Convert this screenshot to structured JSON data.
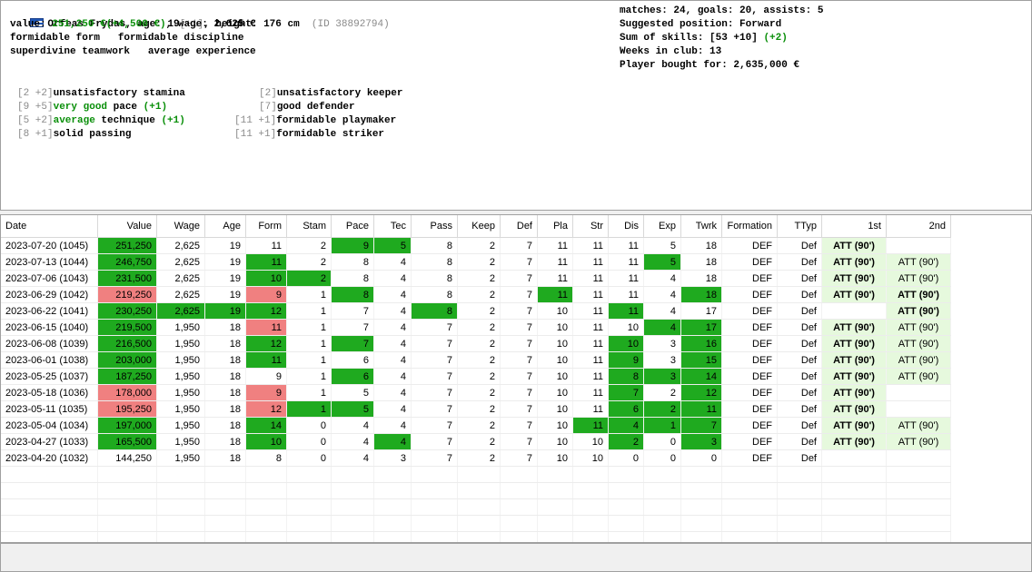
{
  "player": {
    "name": "Orfeas Frydas",
    "age_label": ", age: ",
    "age": "19",
    "age_delta": "[+1]",
    "height_label": ", height: ",
    "height": "176 cm",
    "id": "(ID 38892794)",
    "value_label": "value: ",
    "value": "251,250 €(+4,500 €)",
    "wage_label": ", wage: ",
    "wage": "2,625 €",
    "line3": "formidable form   formidable discipline",
    "line4": "superdivine teamwork   average experience"
  },
  "stats_right": {
    "matches": "matches: 24, goals: 20, assists: 5",
    "position": "Suggested position: Forward",
    "skills_label": "Sum of skills: [53 +10] ",
    "skills_delta": "(+2)",
    "weeks": "Weeks in club: 13",
    "bought": "Player bought for: 2,635,000 €"
  },
  "skills": {
    "stamina_pre": "[2 +2]",
    "stamina": "unsatisfactory stamina",
    "pace_pre": "[9 +5]",
    "pace": "very good",
    "pace_word": " pace ",
    "pace_delta": "(+1)",
    "tech_pre": "[5 +2]",
    "tech": "average",
    "tech_word": " technique ",
    "tech_delta": "(+1)",
    "pass_pre": "[8 +1]",
    "pass": "solid passing",
    "keeper_pre": "[2]",
    "keeper": "unsatisfactory keeper",
    "defender_pre": "[7]",
    "defender": "good defender",
    "playmaker_pre": "[11 +1]",
    "playmaker": "formidable playmaker",
    "striker_pre": "[11 +1]",
    "striker": "formidable striker"
  },
  "colors": {
    "green": "#1faa1f",
    "red": "#f08080",
    "light_green": "#e6f9dd"
  },
  "table": {
    "headers": [
      "Date",
      "Value",
      "Wage",
      "Age",
      "Form",
      "Stam",
      "Pace",
      "Tec",
      "Pass",
      "Keep",
      "Def",
      "Pla",
      "Str",
      "Dis",
      "Exp",
      "Twrk",
      "Formation",
      "TTyp",
      "1st",
      "2nd"
    ],
    "rows": [
      [
        "2023-07-20 (1045)",
        "251,250",
        "2,625",
        "19",
        "11",
        "2",
        "9",
        "5",
        "8",
        "2",
        "7",
        "11",
        "11",
        "11",
        "5",
        "18",
        "DEF",
        "Def",
        "ATT (90')",
        ""
      ],
      [
        "2023-07-13 (1044)",
        "246,750",
        "2,625",
        "19",
        "11",
        "2",
        "8",
        "4",
        "8",
        "2",
        "7",
        "11",
        "11",
        "11",
        "5",
        "18",
        "DEF",
        "Def",
        "ATT (90')",
        "ATT (90')"
      ],
      [
        "2023-07-06 (1043)",
        "231,500",
        "2,625",
        "19",
        "10",
        "2",
        "8",
        "4",
        "8",
        "2",
        "7",
        "11",
        "11",
        "11",
        "4",
        "18",
        "DEF",
        "Def",
        "ATT (90')",
        "ATT (90')"
      ],
      [
        "2023-06-29 (1042)",
        "219,250",
        "2,625",
        "19",
        "9",
        "1",
        "8",
        "4",
        "8",
        "2",
        "7",
        "11",
        "11",
        "11",
        "4",
        "18",
        "DEF",
        "Def",
        "ATT (90')",
        "ATT (90')"
      ],
      [
        "2023-06-22 (1041)",
        "230,250",
        "2,625",
        "19",
        "12",
        "1",
        "7",
        "4",
        "8",
        "2",
        "7",
        "10",
        "11",
        "11",
        "4",
        "17",
        "DEF",
        "Def",
        "",
        "ATT (90')"
      ],
      [
        "2023-06-15 (1040)",
        "219,500",
        "1,950",
        "18",
        "11",
        "1",
        "7",
        "4",
        "7",
        "2",
        "7",
        "10",
        "11",
        "10",
        "4",
        "17",
        "DEF",
        "Def",
        "ATT (90')",
        "ATT (90')"
      ],
      [
        "2023-06-08 (1039)",
        "216,500",
        "1,950",
        "18",
        "12",
        "1",
        "7",
        "4",
        "7",
        "2",
        "7",
        "10",
        "11",
        "10",
        "3",
        "16",
        "DEF",
        "Def",
        "ATT (90')",
        "ATT (90')"
      ],
      [
        "2023-06-01 (1038)",
        "203,000",
        "1,950",
        "18",
        "11",
        "1",
        "6",
        "4",
        "7",
        "2",
        "7",
        "10",
        "11",
        "9",
        "3",
        "15",
        "DEF",
        "Def",
        "ATT (90')",
        "ATT (90')"
      ],
      [
        "2023-05-25 (1037)",
        "187,250",
        "1,950",
        "18",
        "9",
        "1",
        "6",
        "4",
        "7",
        "2",
        "7",
        "10",
        "11",
        "8",
        "3",
        "14",
        "DEF",
        "Def",
        "ATT (90')",
        "ATT (90')"
      ],
      [
        "2023-05-18 (1036)",
        "178,000",
        "1,950",
        "18",
        "9",
        "1",
        "5",
        "4",
        "7",
        "2",
        "7",
        "10",
        "11",
        "7",
        "2",
        "12",
        "DEF",
        "Def",
        "ATT (90')",
        ""
      ],
      [
        "2023-05-11 (1035)",
        "195,250",
        "1,950",
        "18",
        "12",
        "1",
        "5",
        "4",
        "7",
        "2",
        "7",
        "10",
        "11",
        "6",
        "2",
        "11",
        "DEF",
        "Def",
        "ATT (90')",
        ""
      ],
      [
        "2023-05-04 (1034)",
        "197,000",
        "1,950",
        "18",
        "14",
        "0",
        "4",
        "4",
        "7",
        "2",
        "7",
        "10",
        "11",
        "4",
        "1",
        "7",
        "DEF",
        "Def",
        "ATT (90')",
        "ATT (90')"
      ],
      [
        "2023-04-27 (1033)",
        "165,500",
        "1,950",
        "18",
        "10",
        "0",
        "4",
        "4",
        "7",
        "2",
        "7",
        "10",
        "10",
        "2",
        "0",
        "3",
        "DEF",
        "Def",
        "ATT (90')",
        "ATT (90')"
      ],
      [
        "2023-04-20 (1032)",
        "144,250",
        "1,950",
        "18",
        "8",
        "0",
        "4",
        "3",
        "7",
        "2",
        "7",
        "10",
        "10",
        "0",
        "0",
        "0",
        "DEF",
        "Def",
        "",
        ""
      ]
    ],
    "highlights": [
      {
        "1": "g",
        "6": "g",
        "7": "g"
      },
      {
        "1": "g",
        "4": "g",
        "14": "g"
      },
      {
        "1": "g",
        "4": "g",
        "5": "g"
      },
      {
        "1": "r",
        "4": "r",
        "6": "g",
        "11": "g",
        "15": "g"
      },
      {
        "1": "g",
        "2": "g",
        "3": "g",
        "4": "g",
        "8": "g",
        "13": "g"
      },
      {
        "1": "g",
        "4": "r",
        "14": "g",
        "15": "g"
      },
      {
        "1": "g",
        "4": "g",
        "6": "g",
        "13": "g",
        "15": "g"
      },
      {
        "1": "g",
        "4": "g",
        "13": "g",
        "15": "g"
      },
      {
        "1": "g",
        "6": "g",
        "13": "g",
        "14": "g",
        "15": "g"
      },
      {
        "1": "r",
        "4": "r",
        "13": "g",
        "15": "g"
      },
      {
        "1": "r",
        "4": "r",
        "5": "g",
        "6": "g",
        "13": "g",
        "14": "g",
        "15": "g"
      },
      {
        "1": "g",
        "4": "g",
        "12": "g",
        "13": "g",
        "14": "g",
        "15": "g"
      },
      {
        "1": "g",
        "4": "g",
        "7": "g",
        "13": "g",
        "15": "g"
      },
      {}
    ],
    "bold_second": [
      3,
      4
    ],
    "empty_rows": 5
  }
}
